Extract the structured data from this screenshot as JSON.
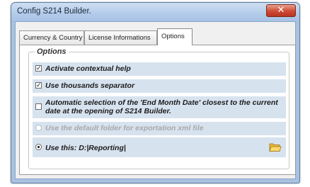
{
  "window": {
    "title": "Config S214 Builder.",
    "close_glyph": "✕"
  },
  "tabs": [
    {
      "label": "Currency & Country"
    },
    {
      "label": "License Informations"
    },
    {
      "label": "Options"
    }
  ],
  "options_group": {
    "label": "Options",
    "items": [
      {
        "label": "Activate contextual help",
        "checked": true
      },
      {
        "label": "Use thousands separator",
        "checked": true
      },
      {
        "label": "Automatic selection of the 'End Month Date' closest to the current date at the opening of S214 Builder.",
        "checked": false
      }
    ],
    "export_radios": [
      {
        "label": "Use the default folder for exportation xml file",
        "selected": false,
        "enabled": false
      },
      {
        "label": "Use this: D:|Reporting|",
        "selected": true,
        "enabled": true
      }
    ],
    "folder_icon": "folder-open-icon"
  },
  "check_glyph": "✓",
  "colors": {
    "title_bar": "#b3cbea",
    "option_row_bg": "#d7e2ef",
    "close_button": "#cd4a33"
  }
}
